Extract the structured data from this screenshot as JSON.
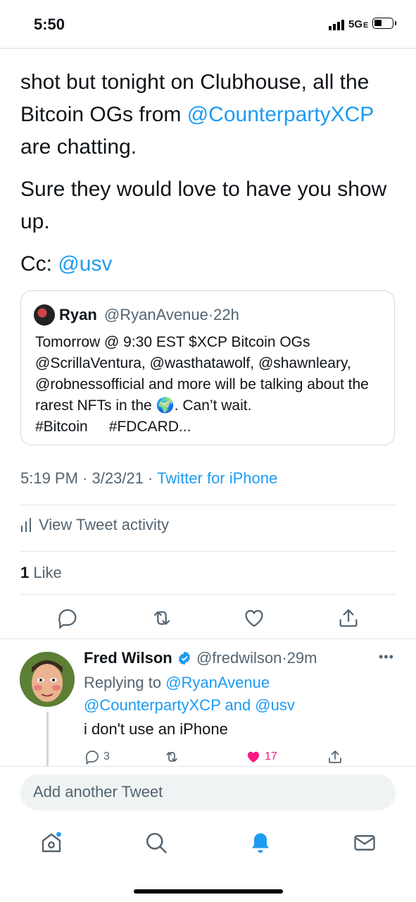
{
  "status": {
    "time": "5:50",
    "network": "5G",
    "network_sub": "E"
  },
  "tweet": {
    "line1": "shot but tonight on Clubhouse, all the Bitcoin OGs from ",
    "mention1": "@CounterpartyXCP",
    "line1b": " are chatting.",
    "para2": "Sure they would love to have you show up.",
    "cc_label": "Cc: ",
    "cc_mention": "@usv"
  },
  "quote": {
    "name": "Ryan",
    "handle": "@RyanAvenue",
    "dot": "·",
    "time": "22h",
    "text1": "Tomorrow @ 9:30 EST $XCP Bitcoin OGs @ScrillaVentura, @wasthatawolf, @shawnleary, @robnessofficial  and more will be talking about the rarest NFTs in the ",
    "emoji": "🌍",
    "text2": ". Can’t wait.",
    "tag1": "#Bitcoin",
    "tag2": "#FDCARD..."
  },
  "meta": {
    "time": "5:19 PM",
    "sep": " · ",
    "date": "3/23/21",
    "sep2": " · ",
    "source": "Twitter for iPhone"
  },
  "activity": {
    "label": "View Tweet activity"
  },
  "likes": {
    "count": "1",
    "label": " Like"
  },
  "reply": {
    "name": "Fred Wilson",
    "handle": "@fredwilson",
    "dot": "·",
    "time": "29m",
    "more": "•••",
    "replying_prefix": "Replying to ",
    "replying_to1": "@RyanAvenue",
    "replying_to2": "@CounterpartyXCP",
    "and": " and ",
    "replying_to3": "@usv",
    "text": "i don't use an iPhone",
    "reply_count": "3",
    "like_count": "17"
  },
  "composer": {
    "placeholder": "Add another Tweet"
  },
  "colors": {
    "accent": "#1d9bf0",
    "like": "#f91880",
    "muted": "#536471"
  }
}
